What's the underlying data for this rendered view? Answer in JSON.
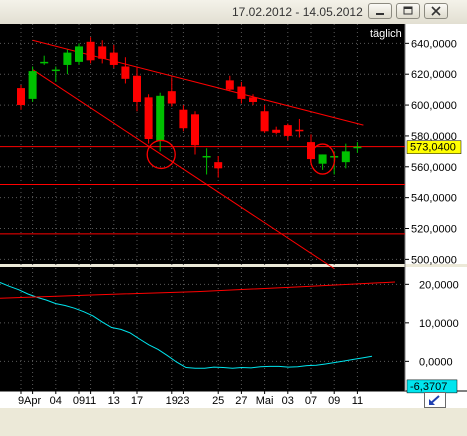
{
  "window": {
    "title": "17.02.2012 - 14.05.2012",
    "buttons": [
      "minimize",
      "restore",
      "close"
    ],
    "mode_label": "täglich"
  },
  "colors": {
    "background": "#000000",
    "up_candle": "#00c000",
    "down_candle": "#ff0000",
    "trendline": "#ff0000",
    "oscillator": "#00e5ee",
    "axis_panel": "#ffffff"
  },
  "icons": {
    "nav_arrow": "arrow-down-left-icon"
  },
  "chart_data": [
    {
      "type": "candlestick",
      "x_tick_labels": [
        "9",
        "Apr",
        "04",
        "09",
        "11",
        "13",
        "17",
        "19",
        "23",
        "25",
        "27",
        "Mai",
        "03",
        "07",
        "09",
        "11"
      ],
      "y_tick_labels": [
        "640,0000",
        "620,0000",
        "600,0000",
        "580,0000",
        "560,0000",
        "540,0000",
        "520,0000",
        "500,0000"
      ],
      "ylim": [
        497,
        648
      ],
      "price_label": "573,0400",
      "horizontal_levels": [
        573.04,
        548.5,
        516.5
      ],
      "trendlines": [
        {
          "from": [
            "Apr",
            642
          ],
          "to": [
            "11",
            587
          ]
        },
        {
          "from": [
            "Apr",
            623
          ],
          "to": [
            "05",
            494
          ]
        }
      ],
      "candles": [
        {
          "open": 611,
          "high": 613,
          "low": 597,
          "close": 600
        },
        {
          "open": 604,
          "high": 625,
          "low": 602,
          "close": 622
        },
        {
          "open": 628,
          "high": 632,
          "low": 626,
          "close": 628
        },
        {
          "open": 623,
          "high": 625,
          "low": 615,
          "close": 623
        },
        {
          "open": 626,
          "high": 636,
          "low": 620,
          "close": 634
        },
        {
          "open": 628,
          "high": 640,
          "low": 626,
          "close": 638
        },
        {
          "open": 641,
          "high": 644,
          "low": 627,
          "close": 629
        },
        {
          "open": 638,
          "high": 642,
          "low": 627,
          "close": 630
        },
        {
          "open": 634,
          "high": 639,
          "low": 624,
          "close": 626
        },
        {
          "open": 625,
          "high": 631,
          "low": 614,
          "close": 617
        },
        {
          "open": 619,
          "high": 625,
          "low": 596,
          "close": 602
        },
        {
          "open": 605,
          "high": 607,
          "low": 575,
          "close": 578
        },
        {
          "open": 577,
          "high": 608,
          "low": 570,
          "close": 606
        },
        {
          "open": 609,
          "high": 618,
          "low": 599,
          "close": 601
        },
        {
          "open": 597,
          "high": 600,
          "low": 583,
          "close": 585
        },
        {
          "open": 594,
          "high": 596,
          "low": 568,
          "close": 574
        },
        {
          "open": 567,
          "high": 572,
          "low": 555,
          "close": 567
        },
        {
          "open": 563,
          "high": 567,
          "low": 553,
          "close": 559
        },
        {
          "open": 616,
          "high": 619,
          "low": 609,
          "close": 610
        },
        {
          "open": 612,
          "high": 615,
          "low": 601,
          "close": 604
        },
        {
          "open": 605,
          "high": 607,
          "low": 600,
          "close": 602
        },
        {
          "open": 596,
          "high": 600,
          "low": 582,
          "close": 583
        },
        {
          "open": 584,
          "high": 586,
          "low": 581,
          "close": 582
        },
        {
          "open": 587,
          "high": 588,
          "low": 577,
          "close": 580
        },
        {
          "open": 584,
          "high": 591,
          "low": 579,
          "close": 583
        },
        {
          "open": 576,
          "high": 581,
          "low": 563,
          "close": 565
        },
        {
          "open": 562,
          "high": 568,
          "low": 558,
          "close": 568
        },
        {
          "open": 566,
          "high": 570,
          "low": 555,
          "close": 567
        },
        {
          "open": 563,
          "high": 575,
          "low": 559,
          "close": 570
        },
        {
          "open": 573,
          "high": 576,
          "low": 569,
          "close": 573
        }
      ]
    },
    {
      "type": "line",
      "y_tick_labels": [
        "20,0000",
        "10,0000",
        "0,0000"
      ],
      "ylim": [
        -7.7,
        24.5
      ],
      "value_label": "-6,3707",
      "series": [
        {
          "values": [
            20.5,
            19.5,
            18.6,
            17.5,
            16.6,
            15.9,
            15,
            14.5,
            13.8,
            12.9,
            11.8,
            10.2,
            8.8,
            8.3,
            7.4,
            5.8,
            4.3,
            3.1,
            1.5,
            -0.2,
            -1.6,
            -1.8,
            -1.8,
            -1.5,
            -1.6,
            -1.8,
            -1.6,
            -1.7,
            -1.4,
            -1.3,
            -1.3,
            -1.5,
            -1.4,
            -1.1,
            -1,
            -0.7,
            -0.3,
            0.1,
            0.5,
            0.9,
            1.3
          ]
        },
        {
          "values": [
            16.4,
            17.3,
            18.1,
            19.3,
            20.6
          ]
        }
      ]
    }
  ]
}
